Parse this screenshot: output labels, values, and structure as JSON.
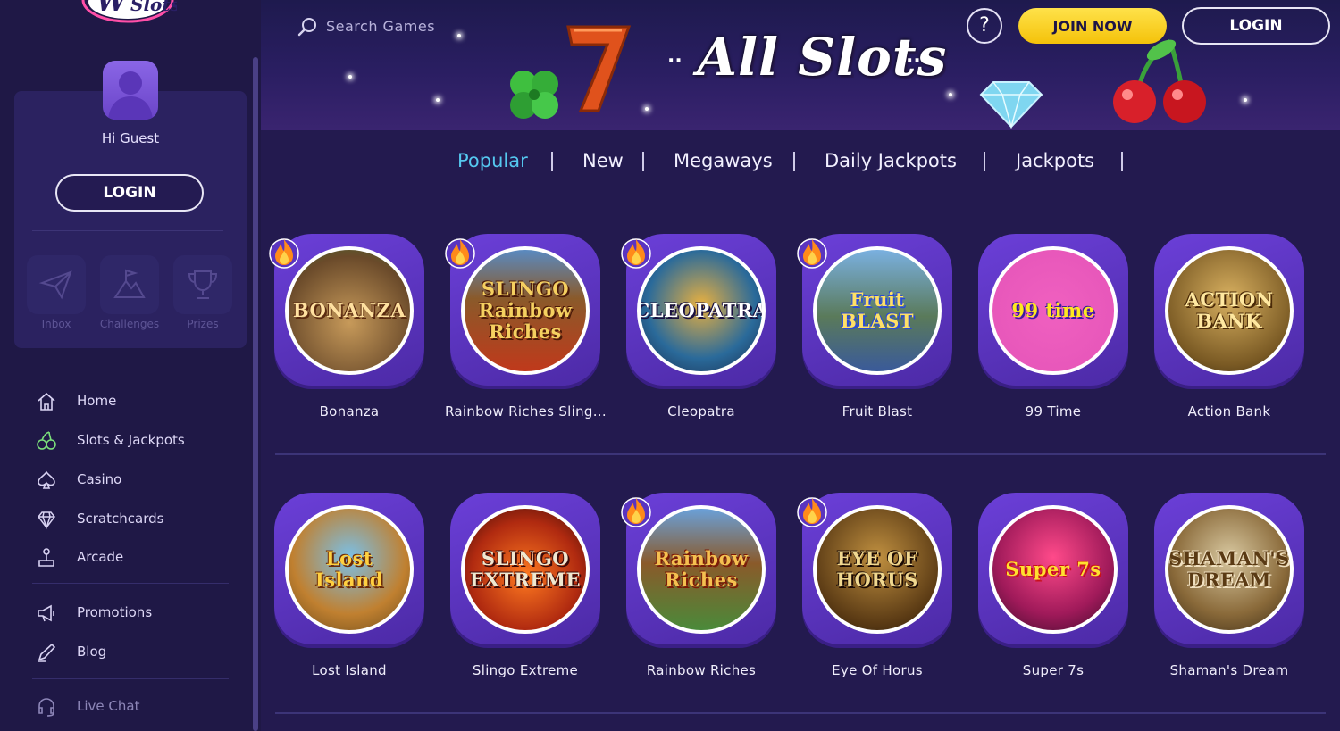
{
  "sidebar": {
    "logo_text": "Slots",
    "greeting": "Hi Guest",
    "login_label": "LOGIN",
    "quick_links": [
      {
        "label": "Inbox",
        "icon": "paper-plane-icon"
      },
      {
        "label": "Challenges",
        "icon": "mountain-flag-icon"
      },
      {
        "label": "Prizes",
        "icon": "trophy-icon"
      }
    ],
    "nav": [
      {
        "label": "Home",
        "icon": "home-icon"
      },
      {
        "label": "Slots & Jackpots",
        "icon": "cherries-icon"
      },
      {
        "label": "Casino",
        "icon": "spade-icon"
      },
      {
        "label": "Scratchcards",
        "icon": "diamond-icon"
      },
      {
        "label": "Arcade",
        "icon": "joystick-icon"
      },
      {
        "label": "Promotions",
        "icon": "megaphone-icon"
      },
      {
        "label": "Blog",
        "icon": "pen-icon"
      },
      {
        "label": "Live Chat",
        "icon": "headset-icon"
      }
    ]
  },
  "header": {
    "search_placeholder": "Search Games",
    "banner_title": "All Slots",
    "help_label": "?",
    "join_label": "JOIN NOW",
    "login_label": "LOGIN"
  },
  "tabs": [
    {
      "label": "Popular",
      "active": true
    },
    {
      "label": "New",
      "active": false
    },
    {
      "label": "Megaways",
      "active": false
    },
    {
      "label": "Daily Jackpots",
      "active": false
    },
    {
      "label": "Jackpots",
      "active": false
    }
  ],
  "games": [
    {
      "name": "Bonanza",
      "art_text": "BONANZA",
      "hot": true
    },
    {
      "name": "Rainbow Riches Sling...",
      "art_text": "SLINGO Rainbow Riches",
      "hot": true
    },
    {
      "name": "Cleopatra",
      "art_text": "CLEOPATRA",
      "hot": true
    },
    {
      "name": "Fruit Blast",
      "art_text": "Fruit BLAST",
      "hot": true
    },
    {
      "name": "99 Time",
      "art_text": "99 time",
      "hot": false
    },
    {
      "name": "Action Bank",
      "art_text": "ACTION BANK",
      "hot": false
    },
    {
      "name": "Lost Island",
      "art_text": "Lost Island",
      "hot": false
    },
    {
      "name": "Slingo Extreme",
      "art_text": "SLINGO EXTREME",
      "hot": false
    },
    {
      "name": "Rainbow Riches",
      "art_text": "Rainbow Riches",
      "hot": true
    },
    {
      "name": "Eye Of Horus",
      "art_text": "EYE OF HORUS",
      "hot": true
    },
    {
      "name": "Super 7s",
      "art_text": "Super 7s",
      "hot": false
    },
    {
      "name": "Shaman's Dream",
      "art_text": "SHAMAN'S DREAM",
      "hot": false
    }
  ],
  "colors": {
    "accent_tab": "#55c8f0",
    "join_button": "#f4c20a",
    "tile_purple": "#6b3fd8",
    "background": "#231a4f"
  }
}
